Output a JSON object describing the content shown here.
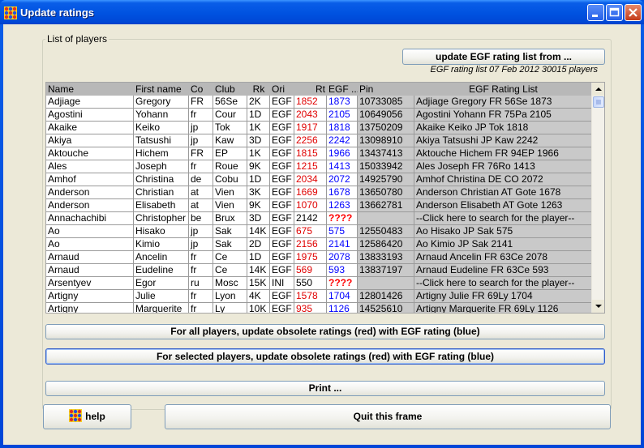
{
  "window": {
    "title": "Update ratings",
    "app_icon": "grid-icon",
    "controls": [
      "minimize-icon",
      "maximize-icon",
      "close-icon"
    ]
  },
  "panel": {
    "title": "List of players",
    "update_button": "update EGF rating list from ...",
    "rating_info": "EGF rating list 07 Feb 2012 30015 players"
  },
  "table": {
    "columns": [
      "Name",
      "First name",
      "Co",
      "Club",
      "Rk",
      "Ori",
      "Rt",
      "EGF ...",
      "Pin",
      "EGF Rating List"
    ],
    "rows": [
      [
        "Adjiage",
        "Gregory",
        "FR",
        "56Se",
        "2K",
        "EGF",
        "1852",
        "1873",
        "10733085",
        "Adjiage Gregory FR 56Se 1873"
      ],
      [
        "Agostini",
        "Yohann",
        "fr",
        "Cour",
        "1D",
        "EGF",
        "2043",
        "2105",
        "10649056",
        "Agostini Yohann FR 75Pa 2105"
      ],
      [
        "Akaike",
        "Keiko",
        "jp",
        "Tok",
        "1K",
        "EGF",
        "1917",
        "1818",
        "13750209",
        "Akaike Keiko JP Tok 1818"
      ],
      [
        "Akiya",
        "Tatsushi",
        "jp",
        "Kaw",
        "3D",
        "EGF",
        "2256",
        "2242",
        "13098910",
        "Akiya Tatsushi JP Kaw 2242"
      ],
      [
        "Aktouche",
        "Hichem",
        "FR",
        "EP",
        "1K",
        "EGF",
        "1815",
        "1966",
        "13437413",
        "Aktouche Hichem FR 94EP 1966"
      ],
      [
        "Ales",
        "Joseph",
        "fr",
        "Roue",
        "9K",
        "EGF",
        "1215",
        "1413",
        "15033942",
        "Ales Joseph FR 76Ro 1413"
      ],
      [
        "Amhof",
        "Christina",
        "de",
        "Cobu",
        "1D",
        "EGF",
        "2034",
        "2072",
        "14925790",
        "Amhof Christina DE CO 2072"
      ],
      [
        "Anderson",
        "Christian",
        "at",
        "Vien",
        "3K",
        "EGF",
        "1669",
        "1678",
        "13650780",
        "Anderson Christian AT Gote 1678"
      ],
      [
        "Anderson",
        "Elisabeth",
        "at",
        "Vien",
        "9K",
        "EGF",
        "1070",
        "1263",
        "13662781",
        "Anderson Elisabeth AT Gote 1263"
      ],
      [
        "Annachachibi",
        "Christopher",
        "be",
        "Brux",
        "3D",
        "EGF",
        "2142",
        "????",
        "",
        "--Click here to search for the player--"
      ],
      [
        "Ao",
        "Hisako",
        "jp",
        "Sak",
        "14K",
        "EGF",
        "675",
        "575",
        "12550483",
        "Ao Hisako JP Sak 575"
      ],
      [
        "Ao",
        "Kimio",
        "jp",
        "Sak",
        "2D",
        "EGF",
        "2156",
        "2141",
        "12586420",
        "Ao Kimio JP Sak 2141"
      ],
      [
        "Arnaud",
        "Ancelin",
        "fr",
        "Ce",
        "1D",
        "EGF",
        "1975",
        "2078",
        "13833193",
        "Arnaud Ancelin FR 63Ce 2078"
      ],
      [
        "Arnaud",
        "Eudeline",
        "fr",
        "Ce",
        "14K",
        "EGF",
        "569",
        "593",
        "13837197",
        "Arnaud Eudeline FR 63Ce 593"
      ],
      [
        "Arsentyev",
        "Egor",
        "ru",
        "Mosc",
        "15K",
        "INI",
        "550",
        "????",
        "",
        "--Click here to search for the player--"
      ],
      [
        "Artigny",
        "Julie",
        "fr",
        "Lyon",
        "4K",
        "EGF",
        "1578",
        "1704",
        "12801426",
        "Artigny Julie FR 69Ly 1704"
      ],
      [
        "Artigny",
        "Marguerite",
        "fr",
        "Ly",
        "10K",
        "EGF",
        "935",
        "1126",
        "14525610",
        "Artigny Marguerite FR 69Ly 1126"
      ]
    ],
    "rating_colors": {
      "obsolete": "#e00000",
      "egf": "#0000ff",
      "missing": "#ff0000"
    }
  },
  "buttons": {
    "update_all": "For all players, update obsolete ratings (red) with EGF rating (blue)",
    "update_selected": "For selected players, update obsolete ratings (red) with EGF rating (blue)",
    "print": "Print ...",
    "help": "help",
    "quit": "Quit this frame"
  }
}
